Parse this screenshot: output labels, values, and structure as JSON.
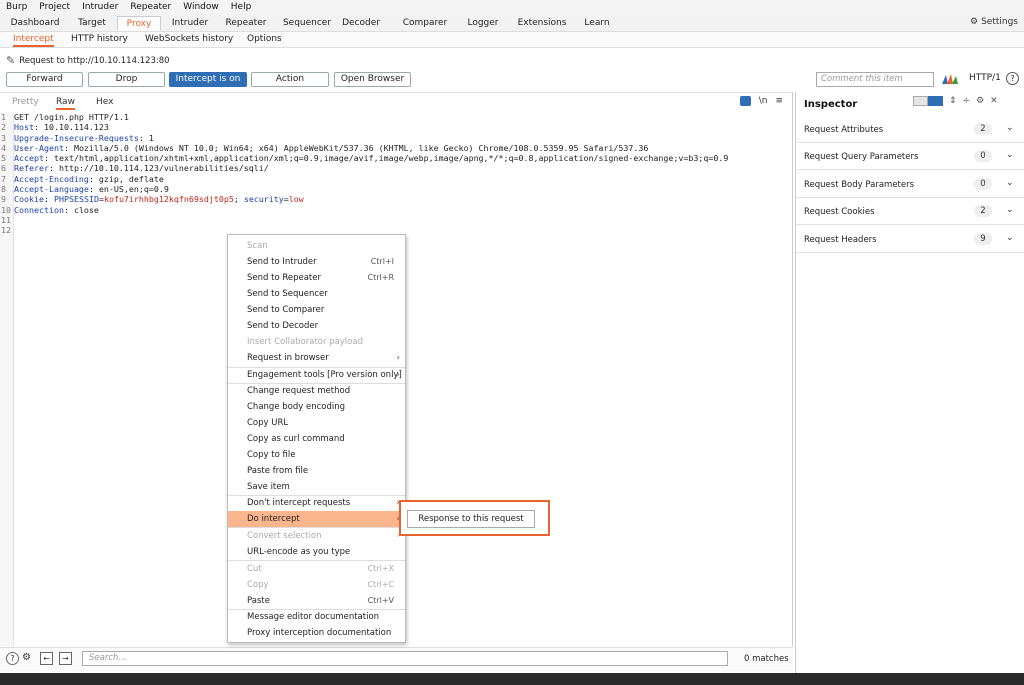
{
  "menubar": [
    "Burp",
    "Project",
    "Intruder",
    "Repeater",
    "Window",
    "Help"
  ],
  "top_tabs": [
    "Dashboard",
    "Target",
    "Proxy",
    "Intruder",
    "Repeater",
    "Sequencer",
    "Decoder",
    "Comparer",
    "Logger",
    "Extensions",
    "Learn"
  ],
  "settings_label": "Settings",
  "sub_tabs": [
    "Intercept",
    "HTTP history",
    "WebSockets history",
    "Options"
  ],
  "request_to": "Request to http://10.10.114.123:80",
  "toolbar": {
    "forward": "Forward",
    "drop": "Drop",
    "intercept": "Intercept is on",
    "action": "Action",
    "open_browser": "Open Browser",
    "comment_placeholder": "Comment this item",
    "http_version": "HTTP/1",
    "help": "?"
  },
  "editor_tabs": [
    "Pretty",
    "Raw",
    "Hex"
  ],
  "editor_icons": {
    "newline": "\\n",
    "menu": "≡"
  },
  "code_lines": [
    {
      "n": "1",
      "k": "",
      "v": "GET /login.php HTTP/1.1"
    },
    {
      "n": "2",
      "k": "Host",
      "v": ": 10.10.114.123"
    },
    {
      "n": "3",
      "k": "Upgrade-Insecure-Requests",
      "v": ": 1"
    },
    {
      "n": "4",
      "k": "User-Agent",
      "v": ": Mozilla/5.0 (Windows NT 10.0; Win64; x64) AppleWebKit/537.36 (KHTML, like Gecko) Chrome/108.0.5359.95 Safari/537.36"
    },
    {
      "n": "5",
      "k": "Accept",
      "v": ": text/html,application/xhtml+xml,application/xml;q=0.9,image/avif,image/webp,image/apng,*/*;q=0.8,application/signed-exchange;v=b3;q=0.9"
    },
    {
      "n": "6",
      "k": "Referer",
      "v": ": http://10.10.114.123/vulnerabilities/sqli/"
    },
    {
      "n": "7",
      "k": "Accept-Encoding",
      "v": ": gzip, deflate"
    },
    {
      "n": "8",
      "k": "Accept-Language",
      "v": ": en-US,en;q=0.9"
    },
    {
      "n": "9",
      "k": "Cookie",
      "v": ""
    },
    {
      "n": "10",
      "k": "Connection",
      "v": ": close"
    },
    {
      "n": "11",
      "k": "",
      "v": ""
    },
    {
      "n": "12",
      "k": "",
      "v": ""
    }
  ],
  "cookie": {
    "sep1": ": ",
    "name1": "PHPSESSID",
    "eq1": "=",
    "val1": "kofu7irhhbg12kqfn69sdjt0p5",
    "sep2": "; ",
    "name2": "security",
    "eq2": "=",
    "val2": "low"
  },
  "inspector": {
    "title": "Inspector",
    "sections": [
      {
        "label": "Request Attributes",
        "count": "2"
      },
      {
        "label": "Request Query Parameters",
        "count": "0"
      },
      {
        "label": "Request Body Parameters",
        "count": "0"
      },
      {
        "label": "Request Cookies",
        "count": "2"
      },
      {
        "label": "Request Headers",
        "count": "9"
      }
    ]
  },
  "context_menu": [
    {
      "label": "Scan",
      "disabled": true
    },
    {
      "label": "Send to Intruder",
      "shortcut": "Ctrl+I"
    },
    {
      "label": "Send to Repeater",
      "shortcut": "Ctrl+R"
    },
    {
      "label": "Send to Sequencer"
    },
    {
      "label": "Send to Comparer"
    },
    {
      "label": "Send to Decoder"
    },
    {
      "label": "Insert Collaborator payload",
      "disabled": true
    },
    {
      "label": "Request in browser",
      "arrow": true
    },
    {
      "label": "Engagement tools [Pro version only]",
      "arrow": true
    },
    {
      "label": "Change request method"
    },
    {
      "label": "Change body encoding"
    },
    {
      "label": "Copy URL"
    },
    {
      "label": "Copy as curl command"
    },
    {
      "label": "Copy to file"
    },
    {
      "label": "Paste from file"
    },
    {
      "label": "Save item"
    },
    {
      "label": "Don't intercept requests",
      "arrow": true
    },
    {
      "label": "Do intercept",
      "arrow": true,
      "highlighted": true
    },
    {
      "label": "Convert selection",
      "disabled": true
    },
    {
      "label": "URL-encode as you type"
    },
    {
      "label": "Cut",
      "shortcut": "Ctrl+X",
      "disabled": true
    },
    {
      "label": "Copy",
      "shortcut": "Ctrl+C",
      "disabled": true
    },
    {
      "label": "Paste",
      "shortcut": "Ctrl+V"
    },
    {
      "label": "Message editor documentation"
    },
    {
      "label": "Proxy interception documentation"
    }
  ],
  "submenu_item": "Response to this request",
  "search": {
    "placeholder": "Search...",
    "matches": "0 matches"
  },
  "colors": {
    "accent": "#e8632d",
    "primary": "#2f6db5",
    "highlight": "#fbb68e"
  }
}
